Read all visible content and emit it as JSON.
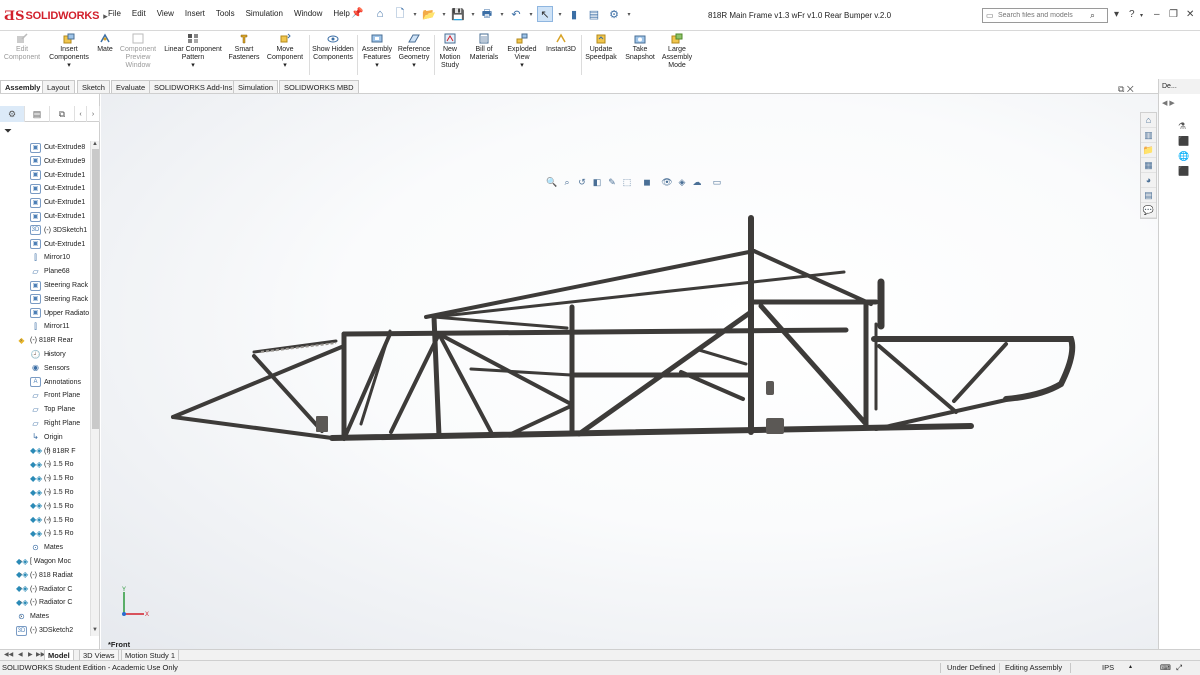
{
  "app": {
    "brand": "SOLIDWORKS",
    "menu": [
      "File",
      "Edit",
      "View",
      "Insert",
      "Tools",
      "Simulation",
      "Window",
      "Help"
    ],
    "document_title": "818R Main Frame v1.3 wFr v1.0 Rear Bumper v.2.0",
    "search_placeholder": "Search files and models",
    "accent_color": "#d21f2b"
  },
  "ribbon": {
    "buttons": [
      {
        "label": "Edit Component",
        "icon": "edit-component-icon",
        "enabled": false
      },
      {
        "label": "Insert Components",
        "icon": "insert-components-icon",
        "enabled": true
      },
      {
        "label": "Mate",
        "icon": "mate-icon",
        "enabled": true
      },
      {
        "label": "Component Preview Window",
        "icon": "component-preview-icon",
        "enabled": false
      },
      {
        "label": "Linear Component Pattern",
        "icon": "linear-pattern-icon",
        "enabled": true
      },
      {
        "label": "Smart Fasteners",
        "icon": "smart-fasteners-icon",
        "enabled": true
      },
      {
        "label": "Move Component",
        "icon": "move-component-icon",
        "enabled": true
      },
      {
        "label": "Show Hidden Components",
        "icon": "show-hidden-icon",
        "enabled": true
      },
      {
        "label": "Assembly Features",
        "icon": "assembly-features-icon",
        "enabled": true
      },
      {
        "label": "Reference Geometry",
        "icon": "reference-geometry-icon",
        "enabled": true
      },
      {
        "label": "New Motion Study",
        "icon": "motion-study-icon",
        "enabled": true
      },
      {
        "label": "Bill of Materials",
        "icon": "bill-of-materials-icon",
        "enabled": true
      },
      {
        "label": "Exploded View",
        "icon": "exploded-view-icon",
        "enabled": true
      },
      {
        "label": "Instant3D",
        "icon": "instant3d-icon",
        "enabled": true
      },
      {
        "label": "Update Speedpak",
        "icon": "speedpak-icon",
        "enabled": true
      },
      {
        "label": "Take Snapshot",
        "icon": "snapshot-icon",
        "enabled": true
      },
      {
        "label": "Large Assembly Mode",
        "icon": "large-assembly-icon",
        "enabled": true
      }
    ]
  },
  "tabs": [
    "Assembly",
    "Layout",
    "Sketch",
    "Evaluate",
    "SOLIDWORKS Add-Ins",
    "Simulation",
    "SOLIDWORKS MBD"
  ],
  "active_tab": "Assembly",
  "tree": [
    {
      "label": "Cut-Extrude8",
      "icon": "feature",
      "expander": true
    },
    {
      "label": "Cut-Extrude9",
      "icon": "feature",
      "expander": true
    },
    {
      "label": "Cut-Extrude1",
      "icon": "feature",
      "expander": true
    },
    {
      "label": "Cut-Extrude1",
      "icon": "feature",
      "expander": true
    },
    {
      "label": "Cut-Extrude1",
      "icon": "feature",
      "expander": true
    },
    {
      "label": "Cut-Extrude1",
      "icon": "feature",
      "expander": true
    },
    {
      "label": "(-) 3DSketch1",
      "icon": "sketch",
      "expander": false
    },
    {
      "label": "Cut-Extrude1",
      "icon": "feature",
      "expander": true
    },
    {
      "label": "Mirror10",
      "icon": "mirror",
      "expander": false
    },
    {
      "label": "Plane68",
      "icon": "plane",
      "expander": false
    },
    {
      "label": "Steering Rack",
      "icon": "feature",
      "expander": true
    },
    {
      "label": "Steering Rack",
      "icon": "feature",
      "expander": true
    },
    {
      "label": "Upper Radiato",
      "icon": "feature",
      "expander": true
    },
    {
      "label": "Mirror11",
      "icon": "mirror",
      "expander": false
    },
    {
      "label": "(-) 818R Rear",
      "icon": "part",
      "expander": true
    },
    {
      "label": "History",
      "icon": "history",
      "expander": true
    },
    {
      "label": "Sensors",
      "icon": "sensor",
      "expander": false
    },
    {
      "label": "Annotations",
      "icon": "annotation",
      "expander": true
    },
    {
      "label": "Front Plane",
      "icon": "plane",
      "expander": false
    },
    {
      "label": "Top Plane",
      "icon": "plane",
      "expander": false
    },
    {
      "label": "Right Plane",
      "icon": "plane",
      "expander": false
    },
    {
      "label": "Origin",
      "icon": "origin",
      "expander": false
    },
    {
      "label": "(f) 818R F",
      "icon": "subassembly",
      "expander": true
    },
    {
      "label": "(-) 1.5 Ro",
      "icon": "subassembly",
      "expander": true
    },
    {
      "label": "(-) 1.5 Ro",
      "icon": "subassembly",
      "expander": true
    },
    {
      "label": "(-) 1.5 Ro",
      "icon": "subassembly",
      "expander": true
    },
    {
      "label": "(-) 1.5 Ro",
      "icon": "subassembly",
      "expander": true
    },
    {
      "label": "(-) 1.5 Ro",
      "icon": "subassembly",
      "expander": true
    },
    {
      "label": "(-) 1.5 Ro",
      "icon": "subassembly",
      "expander": true
    },
    {
      "label": "Mates",
      "icon": "mates",
      "expander": false
    },
    {
      "label": "[ Wagon Moc",
      "icon": "subassembly",
      "expander": true
    },
    {
      "label": "(-) 818 Radiat",
      "icon": "subassembly",
      "expander": true
    },
    {
      "label": "(-) Radiator C",
      "icon": "subassembly",
      "expander": true
    },
    {
      "label": "(-) Radiator C",
      "icon": "subassembly",
      "expander": true
    },
    {
      "label": "Mates",
      "icon": "mates",
      "expander": true
    },
    {
      "label": "(-) 3DSketch2",
      "icon": "sketch",
      "expander": false
    }
  ],
  "viewport": {
    "view_label": "*Front"
  },
  "taskpane": {
    "header": "De..."
  },
  "model_tabs": [
    "Model",
    "3D Views",
    "Motion Study 1"
  ],
  "active_model_tab": "Model",
  "status": {
    "edition": "SOLIDWORKS Student Edition - Academic Use Only",
    "state": "Under Defined",
    "mode": "Editing Assembly",
    "units": "IPS"
  }
}
